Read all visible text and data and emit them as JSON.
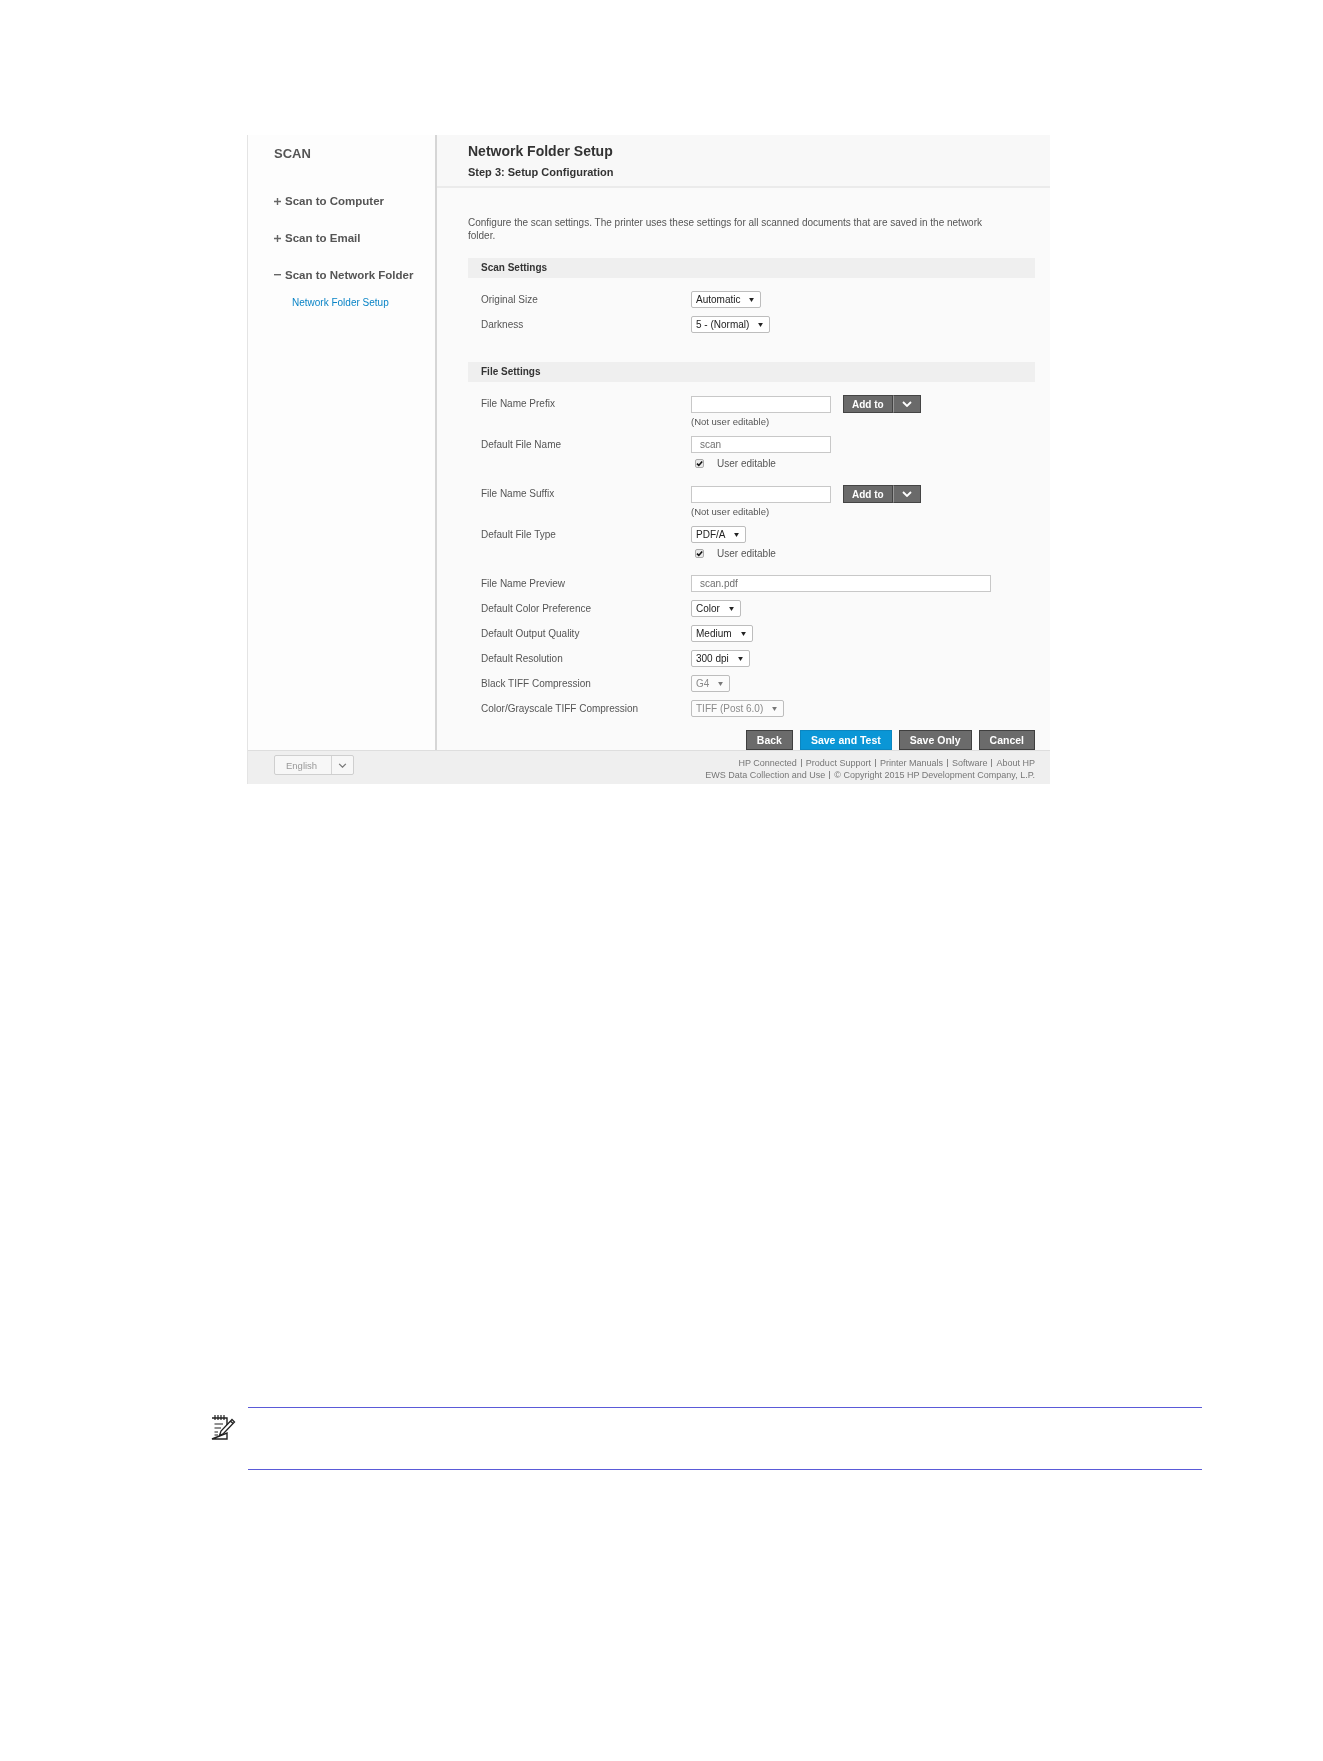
{
  "sidebar": {
    "title": "SCAN",
    "items": [
      {
        "label": "Scan to Computer",
        "expanded": false
      },
      {
        "label": "Scan to Email",
        "expanded": false
      },
      {
        "label": "Scan to Network Folder",
        "expanded": true,
        "children": [
          {
            "label": "Network Folder Setup",
            "selected": true
          }
        ]
      }
    ]
  },
  "header": {
    "title": "Network Folder Setup",
    "subtitle": "Step 3: Setup Configuration"
  },
  "description": "Configure the scan settings. The printer uses these settings for all scanned documents that are saved in the network folder.",
  "sections": [
    {
      "title": "Scan Settings",
      "rows": [
        {
          "kind": "select",
          "label": "Original Size",
          "value": "Automatic",
          "disabled": false
        },
        {
          "kind": "select",
          "label": "Darkness",
          "value": "5 - (Normal)",
          "disabled": false
        }
      ]
    },
    {
      "title": "File Settings",
      "rows": [
        {
          "kind": "input",
          "label": "File Name Prefix",
          "button": "Add to",
          "note": "(Not user editable)"
        },
        {
          "kind": "input",
          "label": "Default File Name",
          "value": "scan",
          "check_label": "User editable",
          "checked": true
        },
        {
          "kind": "input",
          "label": "File Name Suffix",
          "button": "Add to",
          "note": "(Not user editable)"
        },
        {
          "kind": "select",
          "label": "Default File Type",
          "value": "PDF/A",
          "disabled": false,
          "check_label": "User editable",
          "checked": true
        },
        {
          "kind": "preview",
          "label": "File Name Preview",
          "value": "scan.pdf"
        },
        {
          "kind": "select",
          "label": "Default Color Preference",
          "value": "Color",
          "disabled": false
        },
        {
          "kind": "select",
          "label": "Default Output Quality",
          "value": "Medium",
          "disabled": false
        },
        {
          "kind": "select",
          "label": "Default Resolution",
          "value": "300 dpi",
          "disabled": false
        },
        {
          "kind": "select",
          "label": "Black TIFF Compression",
          "value": "G4",
          "disabled": true
        },
        {
          "kind": "select",
          "label": "Color/Grayscale TIFF Compression",
          "value": "TIFF (Post 6.0)",
          "disabled": true
        }
      ]
    }
  ],
  "buttons": [
    {
      "label": "Back",
      "primary": false
    },
    {
      "label": "Save and Test",
      "primary": true
    },
    {
      "label": "Save Only",
      "primary": false
    },
    {
      "label": "Cancel",
      "primary": false
    }
  ],
  "footer": {
    "language": "English",
    "links": [
      "HP Connected",
      "Product Support",
      "Printer Manuals",
      "Software",
      "About HP"
    ],
    "legal_link": "EWS Data Collection and Use",
    "copyright": "© Copyright 2015 HP Development Company, L.P."
  }
}
